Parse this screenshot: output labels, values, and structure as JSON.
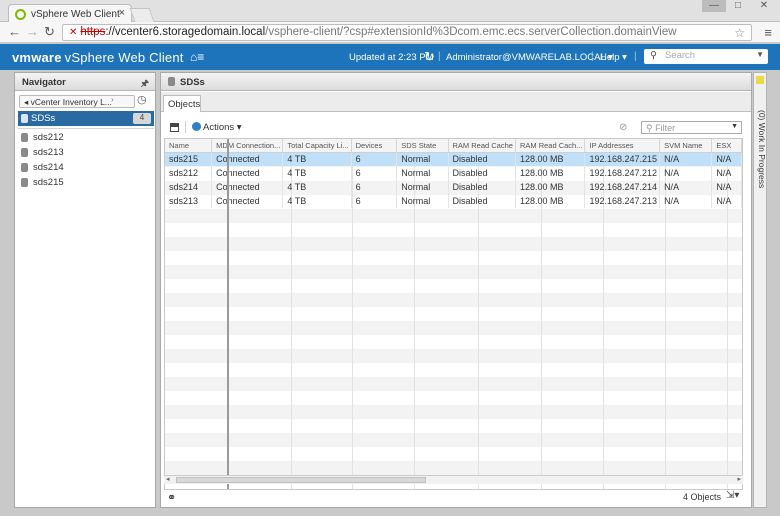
{
  "browser": {
    "tab_title": "vSphere Web Client",
    "tab_close": "×",
    "url_warning": "✕",
    "url_protocol": "https",
    "url_host": "://vcenter6.storagedomain.local",
    "url_path": "/vsphere-client/?csp#extensionId%3Dcom.emc.ecs.serverCollection.domainView"
  },
  "header": {
    "brand_vm": "vmware",
    "brand_product": "vSphere Web Client",
    "home_icon": "⌂≡",
    "updated": "Updated at 2:23 PM",
    "user": "Administrator@VMWARELAB.LOCAL ▾",
    "help": "Help ▾",
    "search_placeholder": "Search"
  },
  "navigator": {
    "title": "Navigator",
    "breadcrumb": "◂ vCenter Inventory L...",
    "selected": "SDSs",
    "selected_count": "4",
    "items": [
      "sds212",
      "sds213",
      "sds214",
      "sds215"
    ]
  },
  "main": {
    "title": "SDSs",
    "tab": "Objects",
    "actions_label": "Actions ▾",
    "filter_placeholder": "Filter",
    "columns": [
      "Name",
      "MDM Connection...",
      "Total Capacity Li...",
      "Devices",
      "SDS State",
      "RAM Read Cache",
      "RAM Read Cach...",
      "IP Addresses",
      "SVM Name",
      "ESX"
    ],
    "rows": [
      [
        "sds215",
        "Connected",
        "4 TB",
        "6",
        "Normal",
        "Disabled",
        "128.00 MB",
        "192.168.247.215",
        "N/A",
        "N/A"
      ],
      [
        "sds212",
        "Connected",
        "4 TB",
        "6",
        "Normal",
        "Disabled",
        "128.00 MB",
        "192.168.247.212",
        "N/A",
        "N/A"
      ],
      [
        "sds214",
        "Connected",
        "4 TB",
        "6",
        "Normal",
        "Disabled",
        "128.00 MB",
        "192.168.247.214",
        "N/A",
        "N/A"
      ],
      [
        "sds213",
        "Connected",
        "4 TB",
        "6",
        "Normal",
        "Disabled",
        "128.00 MB",
        "192.168.247.213",
        "N/A",
        "N/A"
      ]
    ],
    "object_count": "4 Objects"
  },
  "sidebar_right": {
    "label": "(0) Work In Progress"
  },
  "colors": {
    "header_blue": "#1e74ba",
    "selection_blue": "#2a6aa3",
    "row_selected": "#bfe0f8"
  }
}
